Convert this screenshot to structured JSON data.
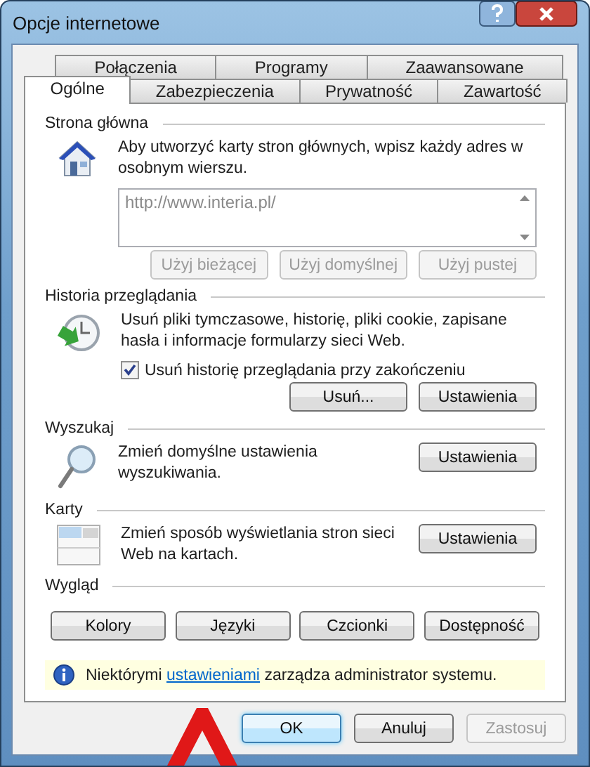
{
  "window": {
    "title": "Opcje internetowe"
  },
  "tab_rows": [
    [
      {
        "label": "Połączenia",
        "selected": false
      },
      {
        "label": "Programy",
        "selected": false
      },
      {
        "label": "Zaawansowane",
        "selected": false
      }
    ],
    [
      {
        "label": "Ogólne",
        "selected": true
      },
      {
        "label": "Zabezpieczenia",
        "selected": false
      },
      {
        "label": "Prywatność",
        "selected": false
      },
      {
        "label": "Zawartość",
        "selected": false
      }
    ]
  ],
  "home_page": {
    "title": "Strona główna",
    "description": "Aby utworzyć karty stron głównych, wpisz każdy adres w osobnym wierszu.",
    "url": "http://www.interia.pl/",
    "buttons": [
      {
        "label": "Użyj bieżącej",
        "disabled": true
      },
      {
        "label": "Użyj domyślnej",
        "disabled": true
      },
      {
        "label": "Użyj pustej",
        "disabled": true
      }
    ]
  },
  "history": {
    "title": "Historia przeglądania",
    "description": "Usuń pliki tymczasowe, historię, pliki cookie, zapisane hasła i informacje formularzy sieci Web.",
    "checkbox": {
      "label": "Usuń historię przeglądania przy zakończeniu",
      "checked": true
    },
    "buttons": [
      {
        "label": "Usuń...",
        "disabled": false
      },
      {
        "label": "Ustawienia",
        "disabled": false
      }
    ]
  },
  "search": {
    "title": "Wyszukaj",
    "description": "Zmień domyślne ustawienia wyszukiwania.",
    "button": "Ustawienia"
  },
  "tabs_section": {
    "title": "Karty",
    "description": "Zmień sposób wyświetlania stron sieci Web na kartach.",
    "button": "Ustawienia"
  },
  "appearance": {
    "title": "Wygląd",
    "buttons": [
      "Kolory",
      "Języki",
      "Czcionki",
      "Dostępność"
    ]
  },
  "notice": {
    "before": "Niektórymi ",
    "link": "ustawieniami",
    "after": " zarządza administrator systemu."
  },
  "dialog_buttons": [
    {
      "label": "OK",
      "focused": true,
      "disabled": false
    },
    {
      "label": "Anuluj",
      "focused": false,
      "disabled": false
    },
    {
      "label": "Zastosuj",
      "focused": false,
      "disabled": true
    }
  ]
}
